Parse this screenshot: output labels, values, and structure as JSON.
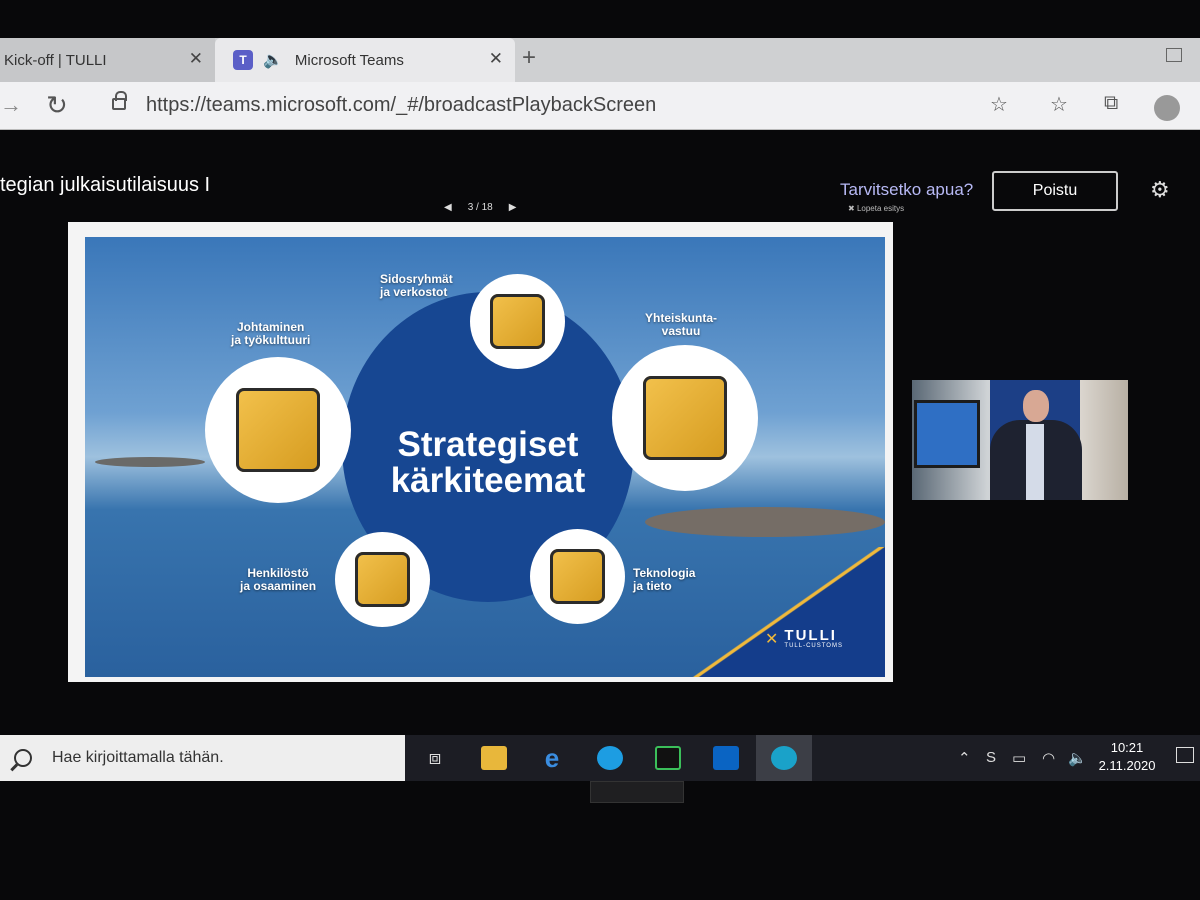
{
  "browser": {
    "tabs": [
      {
        "label": "Kick-off | TULLI"
      },
      {
        "label": "Microsoft Teams"
      }
    ],
    "url": "https://teams.microsoft.com/_#/broadcastPlaybackScreen"
  },
  "event": {
    "title": "tegian julkaisutilaisuus I",
    "pager": "3 / 18",
    "help": "Tarvitsetko apua?",
    "end_presentation": "Lopeta esitys",
    "leave_button": "Poistu"
  },
  "slide": {
    "title_line1": "Strategiset",
    "title_line2": "kärkiteemat",
    "themes": [
      {
        "l1": "Sidosryhmät",
        "l2": "ja verkostot"
      },
      {
        "l1": "Yhteiskunta-",
        "l2": "vastuu"
      },
      {
        "l1": "Johtaminen",
        "l2": "ja työkulttuuri"
      },
      {
        "l1": "Henkilöstö",
        "l2": "ja osaaminen"
      },
      {
        "l1": "Teknologia",
        "l2": "ja tieto"
      }
    ],
    "logo_main": "TULLI",
    "logo_sub": "TULL-CUSTOMS",
    "colors": {
      "navy": "#174792",
      "gold": "#f0b93b"
    }
  },
  "taskbar": {
    "search_placeholder": "Hae kirjoittamalla tähän.",
    "time": "10:21",
    "date": "2.11.2020"
  }
}
